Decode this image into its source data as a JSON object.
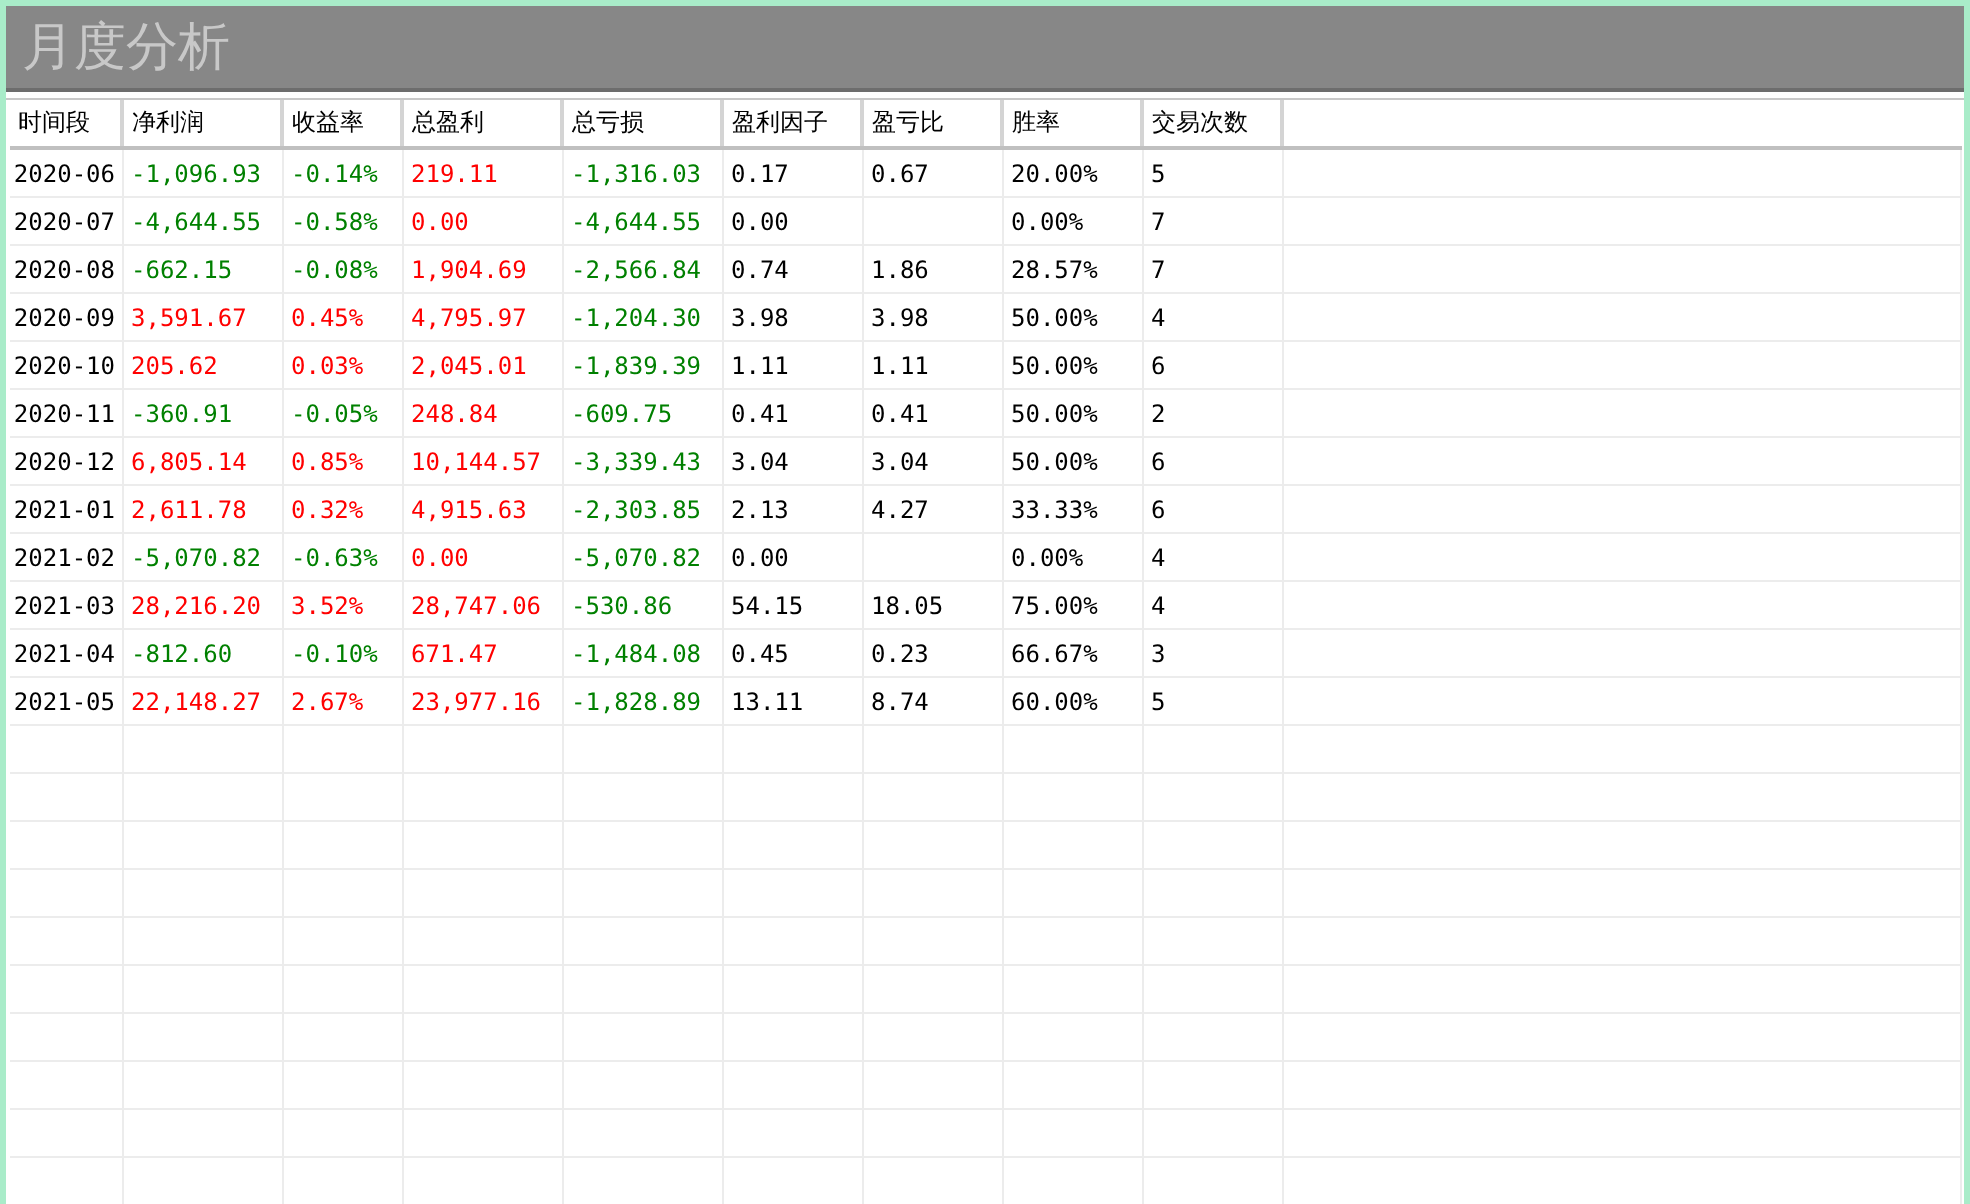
{
  "title": "月度分析",
  "table": {
    "columns": [
      "时间段",
      "净利润",
      "收益率",
      "总盈利",
      "总亏损",
      "盈利因子",
      "盈亏比",
      "胜率",
      "交易次数"
    ],
    "rows": [
      [
        {
          "text": "2020-06",
          "color": "#000000"
        },
        {
          "text": "-1,096.93",
          "color": "#008000"
        },
        {
          "text": "-0.14%",
          "color": "#008000"
        },
        {
          "text": "219.11",
          "color": "#ff0000"
        },
        {
          "text": "-1,316.03",
          "color": "#008000"
        },
        {
          "text": "0.17",
          "color": "#000000"
        },
        {
          "text": "0.67",
          "color": "#000000"
        },
        {
          "text": "20.00%",
          "color": "#000000"
        },
        {
          "text": "5",
          "color": "#000000"
        }
      ],
      [
        {
          "text": "2020-07",
          "color": "#000000"
        },
        {
          "text": "-4,644.55",
          "color": "#008000"
        },
        {
          "text": "-0.58%",
          "color": "#008000"
        },
        {
          "text": "0.00",
          "color": "#ff0000"
        },
        {
          "text": "-4,644.55",
          "color": "#008000"
        },
        {
          "text": "0.00",
          "color": "#000000"
        },
        null,
        {
          "text": "0.00%",
          "color": "#000000"
        },
        {
          "text": "7",
          "color": "#000000"
        }
      ],
      [
        {
          "text": "2020-08",
          "color": "#000000"
        },
        {
          "text": "-662.15",
          "color": "#008000"
        },
        {
          "text": "-0.08%",
          "color": "#008000"
        },
        {
          "text": "1,904.69",
          "color": "#ff0000"
        },
        {
          "text": "-2,566.84",
          "color": "#008000"
        },
        {
          "text": "0.74",
          "color": "#000000"
        },
        {
          "text": "1.86",
          "color": "#000000"
        },
        {
          "text": "28.57%",
          "color": "#000000"
        },
        {
          "text": "7",
          "color": "#000000"
        }
      ],
      [
        {
          "text": "2020-09",
          "color": "#000000"
        },
        {
          "text": "3,591.67",
          "color": "#ff0000"
        },
        {
          "text": "0.45%",
          "color": "#ff0000"
        },
        {
          "text": "4,795.97",
          "color": "#ff0000"
        },
        {
          "text": "-1,204.30",
          "color": "#008000"
        },
        {
          "text": "3.98",
          "color": "#000000"
        },
        {
          "text": "3.98",
          "color": "#000000"
        },
        {
          "text": "50.00%",
          "color": "#000000"
        },
        {
          "text": "4",
          "color": "#000000"
        }
      ],
      [
        {
          "text": "2020-10",
          "color": "#000000"
        },
        {
          "text": "205.62",
          "color": "#ff0000"
        },
        {
          "text": "0.03%",
          "color": "#ff0000"
        },
        {
          "text": "2,045.01",
          "color": "#ff0000"
        },
        {
          "text": "-1,839.39",
          "color": "#008000"
        },
        {
          "text": "1.11",
          "color": "#000000"
        },
        {
          "text": "1.11",
          "color": "#000000"
        },
        {
          "text": "50.00%",
          "color": "#000000"
        },
        {
          "text": "6",
          "color": "#000000"
        }
      ],
      [
        {
          "text": "2020-11",
          "color": "#000000"
        },
        {
          "text": "-360.91",
          "color": "#008000"
        },
        {
          "text": "-0.05%",
          "color": "#008000"
        },
        {
          "text": "248.84",
          "color": "#ff0000"
        },
        {
          "text": "-609.75",
          "color": "#008000"
        },
        {
          "text": "0.41",
          "color": "#000000"
        },
        {
          "text": "0.41",
          "color": "#000000"
        },
        {
          "text": "50.00%",
          "color": "#000000"
        },
        {
          "text": "2",
          "color": "#000000"
        }
      ],
      [
        {
          "text": "2020-12",
          "color": "#000000"
        },
        {
          "text": "6,805.14",
          "color": "#ff0000"
        },
        {
          "text": "0.85%",
          "color": "#ff0000"
        },
        {
          "text": "10,144.57",
          "color": "#ff0000"
        },
        {
          "text": "-3,339.43",
          "color": "#008000"
        },
        {
          "text": "3.04",
          "color": "#000000"
        },
        {
          "text": "3.04",
          "color": "#000000"
        },
        {
          "text": "50.00%",
          "color": "#000000"
        },
        {
          "text": "6",
          "color": "#000000"
        }
      ],
      [
        {
          "text": "2021-01",
          "color": "#000000"
        },
        {
          "text": "2,611.78",
          "color": "#ff0000"
        },
        {
          "text": "0.32%",
          "color": "#ff0000"
        },
        {
          "text": "4,915.63",
          "color": "#ff0000"
        },
        {
          "text": "-2,303.85",
          "color": "#008000"
        },
        {
          "text": "2.13",
          "color": "#000000"
        },
        {
          "text": "4.27",
          "color": "#000000"
        },
        {
          "text": "33.33%",
          "color": "#000000"
        },
        {
          "text": "6",
          "color": "#000000"
        }
      ],
      [
        {
          "text": "2021-02",
          "color": "#000000"
        },
        {
          "text": "-5,070.82",
          "color": "#008000"
        },
        {
          "text": "-0.63%",
          "color": "#008000"
        },
        {
          "text": "0.00",
          "color": "#ff0000"
        },
        {
          "text": "-5,070.82",
          "color": "#008000"
        },
        {
          "text": "0.00",
          "color": "#000000"
        },
        null,
        {
          "text": "0.00%",
          "color": "#000000"
        },
        {
          "text": "4",
          "color": "#000000"
        }
      ],
      [
        {
          "text": "2021-03",
          "color": "#000000"
        },
        {
          "text": "28,216.20",
          "color": "#ff0000"
        },
        {
          "text": "3.52%",
          "color": "#ff0000"
        },
        {
          "text": "28,747.06",
          "color": "#ff0000"
        },
        {
          "text": "-530.86",
          "color": "#008000"
        },
        {
          "text": "54.15",
          "color": "#000000"
        },
        {
          "text": "18.05",
          "color": "#000000"
        },
        {
          "text": "75.00%",
          "color": "#000000"
        },
        {
          "text": "4",
          "color": "#000000"
        }
      ],
      [
        {
          "text": "2021-04",
          "color": "#000000"
        },
        {
          "text": "-812.60",
          "color": "#008000"
        },
        {
          "text": "-0.10%",
          "color": "#008000"
        },
        {
          "text": "671.47",
          "color": "#ff0000"
        },
        {
          "text": "-1,484.08",
          "color": "#008000"
        },
        {
          "text": "0.45",
          "color": "#000000"
        },
        {
          "text": "0.23",
          "color": "#000000"
        },
        {
          "text": "66.67%",
          "color": "#000000"
        },
        {
          "text": "3",
          "color": "#000000"
        }
      ],
      [
        {
          "text": "2021-05",
          "color": "#000000"
        },
        {
          "text": "22,148.27",
          "color": "#ff0000"
        },
        {
          "text": "2.67%",
          "color": "#ff0000"
        },
        {
          "text": "23,977.16",
          "color": "#ff0000"
        },
        {
          "text": "-1,828.89",
          "color": "#008000"
        },
        {
          "text": "13.11",
          "color": "#000000"
        },
        {
          "text": "8.74",
          "color": "#000000"
        },
        {
          "text": "60.00%",
          "color": "#000000"
        },
        {
          "text": "5",
          "color": "#000000"
        }
      ]
    ]
  }
}
